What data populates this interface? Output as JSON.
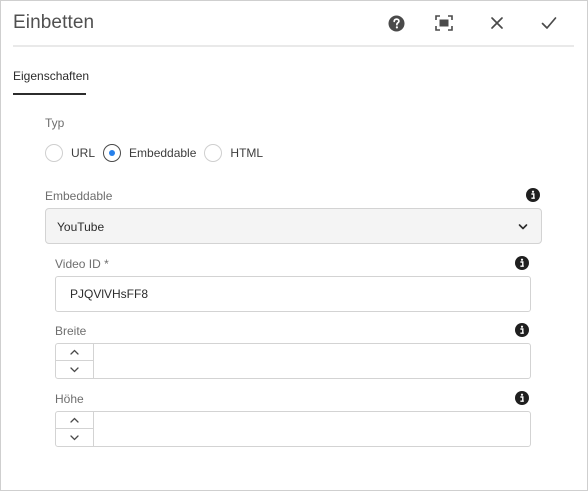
{
  "header": {
    "title": "Einbetten",
    "actions": [
      {
        "name": "help",
        "icon": "help-icon"
      },
      {
        "name": "fullscreen",
        "icon": "fullscreen-icon"
      },
      {
        "name": "close",
        "icon": "close-icon"
      },
      {
        "name": "confirm",
        "icon": "checkmark-icon"
      }
    ]
  },
  "tabs": [
    {
      "label": "Eigenschaften",
      "selected": true
    }
  ],
  "form": {
    "type": {
      "label": "Typ",
      "options": [
        {
          "label": "URL",
          "checked": false
        },
        {
          "label": "Embeddable",
          "checked": true
        },
        {
          "label": "HTML",
          "checked": false
        }
      ]
    },
    "embeddable": {
      "label": "Embeddable",
      "value": "YouTube",
      "info_icon": "info-icon"
    },
    "video_id": {
      "label": "Video ID *",
      "value": "PJQVlVHsFF8",
      "info_icon": "info-icon"
    },
    "width": {
      "label": "Breite",
      "value": "",
      "info_icon": "info-icon"
    },
    "height": {
      "label": "Höhe",
      "value": "",
      "info_icon": "info-icon"
    }
  },
  "colors": {
    "accent": "#2680eb",
    "text_dark": "#2c2c2c",
    "text_label": "#6e6e6e",
    "border": "#d3d3d3"
  }
}
